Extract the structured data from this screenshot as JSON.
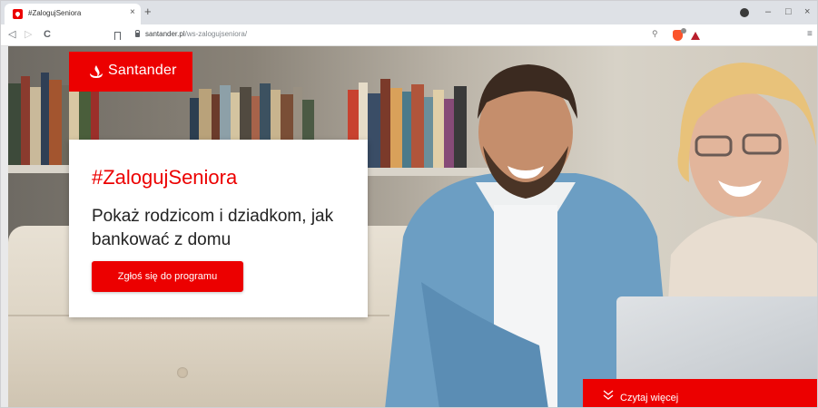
{
  "browser": {
    "tab": {
      "title": "#ZalogujSeniora",
      "close": "×"
    },
    "new_tab": "+",
    "window_controls": {
      "minimize": "–",
      "maximize": "□",
      "close": "×"
    },
    "nav": {
      "back": "◁",
      "forward": "▷",
      "reload": "C"
    },
    "url": {
      "host": "santander.pl",
      "path": "/ws-zalogujseniora/"
    },
    "menu": "≡",
    "zoom_icon": "search-icon",
    "extension_icons": [
      "brave-shield-icon",
      "triangle-icon"
    ]
  },
  "page": {
    "brand": {
      "name": "Santander",
      "color": "#ec0000"
    },
    "hero": {
      "hashtag": "#ZalogujSeniora",
      "headline": "Pokaż rodzicom i dziadkom, jak bankować z domu",
      "cta_label": "Zgłoś się do programu"
    },
    "read_more": {
      "label": "Czytaj więcej",
      "icon": "double-chevron-down-icon"
    }
  }
}
